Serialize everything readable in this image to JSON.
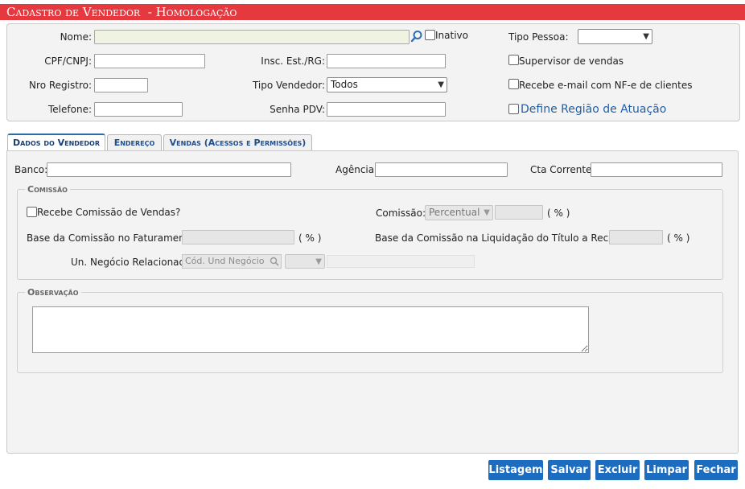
{
  "title": "Cadastro de Vendedor  - Homologação",
  "header_form": {
    "nome_label": "Nome:",
    "inativo_label": "Inativo",
    "tipo_pessoa_label": "Tipo Pessoa:",
    "tipo_pessoa_value": "",
    "cpf_label": "CPF/CNPJ:",
    "insc_label": "Insc. Est./RG:",
    "supervisor_label": "Supervisor de vendas",
    "registro_label": "Nro Registro:",
    "tipo_vendedor_label": "Tipo Vendedor:",
    "tipo_vendedor_value": "Todos",
    "nfe_label": "Recebe e-mail com NF-e de clientes",
    "telefone_label": "Telefone:",
    "senha_label": "Senha PDV:",
    "regiao_link": "Define Região de Atuação"
  },
  "tabs": [
    {
      "label": "Dados do Vendedor",
      "active": true
    },
    {
      "label": "Endereço",
      "active": false
    },
    {
      "label": "Vendas (Acessos e Permissões)",
      "active": false
    }
  ],
  "dados": {
    "banco_label": "Banco:",
    "agencia_label": "Agência:",
    "cta_label": "Cta Corrente:"
  },
  "comissao": {
    "legend": "Comissão",
    "recebe_label": "Recebe Comissão de Vendas?",
    "comissao_label": "Comissão:",
    "comissao_type": "Percentual",
    "pct1": "( % )",
    "base_fat_label": "Base da Comissão no Faturamento:",
    "pct2": "( % )",
    "base_liq_label": "Base da Comissão na Liquidação do Título a Receber:",
    "pct3": "( % )",
    "un_label": "Un. Negócio Relacionada:",
    "un_placeholder": "Cód. Und Negócio"
  },
  "observacao": {
    "legend": "Observação"
  },
  "buttons": {
    "listagem": "Listagem",
    "salvar": "Salvar",
    "excluir": "Excluir",
    "limpar": "Limpar",
    "fechar": "Fechar"
  },
  "colors": {
    "title_bar": "#e6383f",
    "button": "#1c6dbf",
    "link": "#1f5fa8"
  }
}
